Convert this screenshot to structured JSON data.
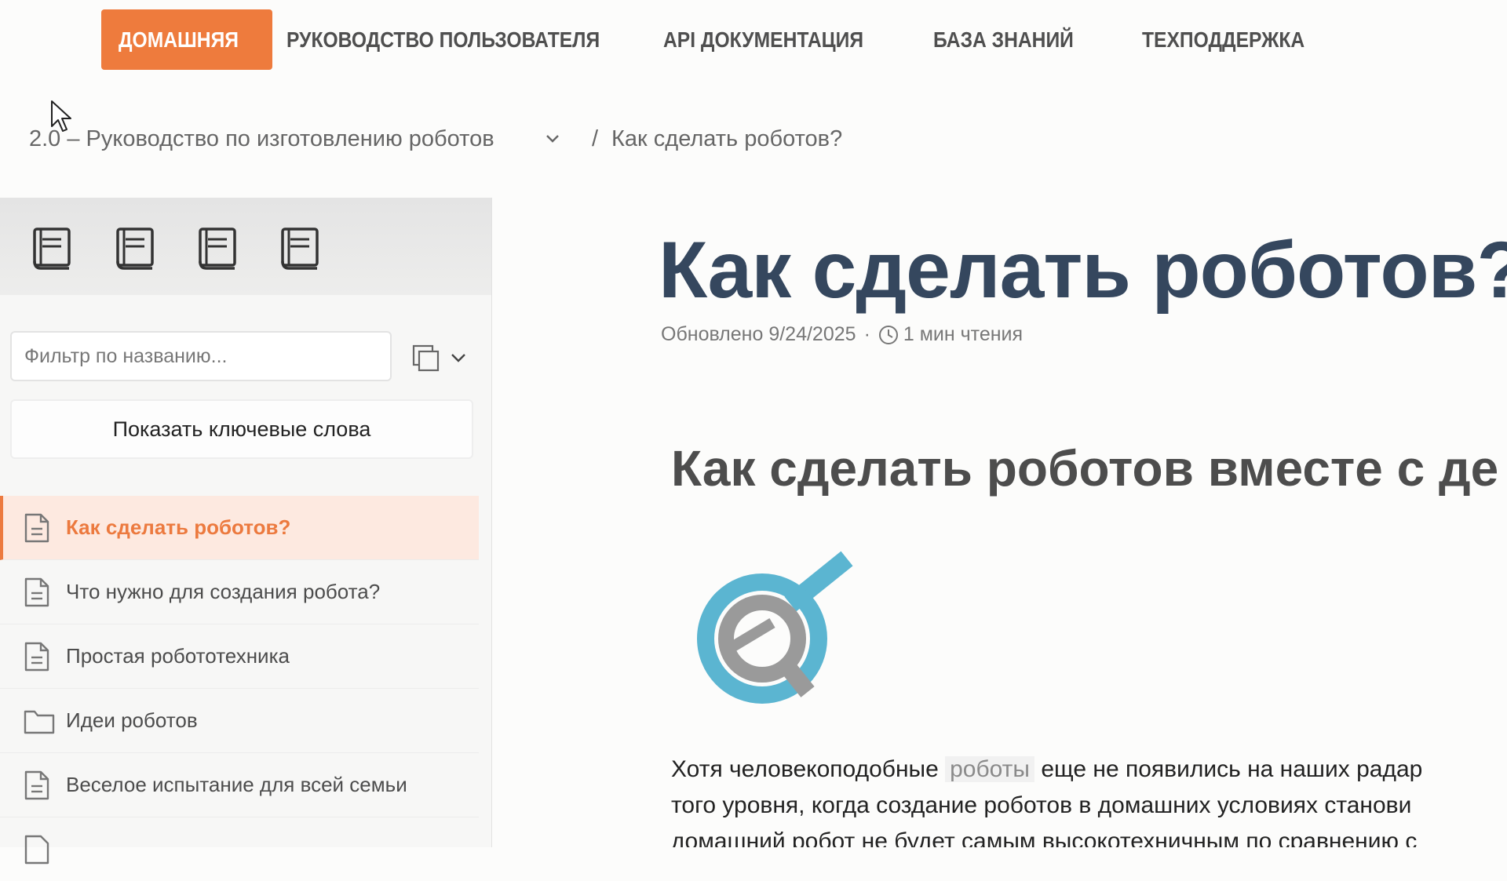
{
  "topnav": {
    "items": [
      {
        "label": "ДОМАШНЯЯ",
        "active": true
      },
      {
        "label": "РУКОВОДСТВО ПОЛЬЗОВАТЕЛЯ"
      },
      {
        "label": "API ДОКУМЕНТАЦИЯ"
      },
      {
        "label": "БАЗА ЗНАНИЙ"
      },
      {
        "label": "ТЕХПОДДЕРЖКА"
      }
    ],
    "active_color": "#ee7b3d"
  },
  "breadcrumb": {
    "parent": "2.0 – Руководство по изготовлению роботов",
    "separator": "/",
    "current": "Как сделать роботов?"
  },
  "sidebar": {
    "filter_placeholder": "Фильтр по названию...",
    "keywords_button": "Показать ключевые слова",
    "items": [
      {
        "label": "Как сделать роботов?",
        "icon": "document-icon",
        "active": true
      },
      {
        "label": "Что нужно для создания робота?",
        "icon": "document-icon"
      },
      {
        "label": "Простая робототехника",
        "icon": "document-icon"
      },
      {
        "label": "Идеи роботов",
        "icon": "folder-icon"
      },
      {
        "label": "Веселое испытание для всей семьи",
        "icon": "document-icon"
      }
    ]
  },
  "article": {
    "title": "Как сделать роботов?",
    "updated": "Обновлено 9/24/2025",
    "meta_dot": "·",
    "read_time": "1 мин чтения",
    "section_title": "Как сделать роботов вместе с де",
    "para_line1_a": "Хотя человекоподобные",
    "para_line1_kw": "роботы",
    "para_line1_b": "еще не появились на наших радар",
    "para_line2": "того уровня, когда создание роботов в домашних условиях станови",
    "para_line3": "домашний робот не будет самым высокотехничным по сравнению с"
  },
  "colors": {
    "accent": "#ee7b3d",
    "title": "#35475e",
    "logo_blue": "#5bb5d1",
    "logo_gray": "#9a9a9a"
  }
}
